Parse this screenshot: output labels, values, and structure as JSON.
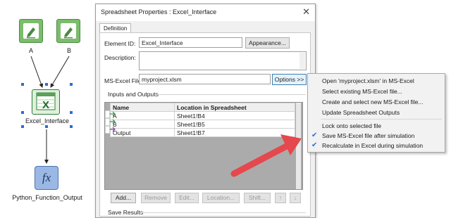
{
  "canvas": {
    "nodes": [
      {
        "id": "a",
        "label": "A"
      },
      {
        "id": "b",
        "label": "B"
      },
      {
        "id": "excel",
        "label": "Excel_Interface"
      },
      {
        "id": "python",
        "label": "Python_Function_Output"
      }
    ],
    "excel_icon_letter": "X",
    "fx_symbol": "fx"
  },
  "dialog": {
    "title": "Spreadsheet Properties : Excel_Interface",
    "close_glyph": "✕",
    "tab": "Definition",
    "element_id_label": "Element ID:",
    "element_id_value": "Excel_Interface",
    "appearance_button": "Appearance...",
    "description_label": "Description:",
    "description_value": "",
    "excel_file_label": "MS-Excel File:",
    "excel_file_value": "myproject.xlsm",
    "options_button": "Options >>",
    "inputs_outputs_label": "Inputs and Outputs",
    "table": {
      "headers": [
        "Name",
        "Location in Spreadsheet"
      ],
      "rows": [
        {
          "name": "A",
          "location": "Sheet1!B4"
        },
        {
          "name": "B",
          "location": "Sheet1!B5"
        },
        {
          "name": "Output",
          "location": "Sheet1!B7"
        }
      ]
    },
    "buttons": {
      "add": "Add...",
      "remove": "Remove",
      "edit": "Edit...",
      "location": "Location...",
      "shift": "Shift...",
      "up": "↑",
      "down": "↓"
    },
    "save_results_label": "Save Results"
  },
  "context_menu": {
    "items": [
      {
        "label": "Open 'myproject.xlsm' in MS-Excel",
        "checked": false
      },
      {
        "label": "Select existing MS-Excel file...",
        "checked": false
      },
      {
        "label": "Create and select new MS-Excel file...",
        "checked": false
      },
      {
        "label": "Update Spreadsheet Outputs",
        "checked": false
      },
      {
        "label": "Lock onto selected file",
        "checked": false
      },
      {
        "label": "Save MS-Excel file after simulation",
        "checked": true
      },
      {
        "label": "Recalculate in Excel during simulation",
        "checked": true
      }
    ],
    "check_glyph": "✔"
  },
  "colors": {
    "callout_arrow": "#e5484d",
    "node_green": "#7bbd6b",
    "node_blue": "#9bb8e4",
    "selection": "#2d6fcf"
  }
}
